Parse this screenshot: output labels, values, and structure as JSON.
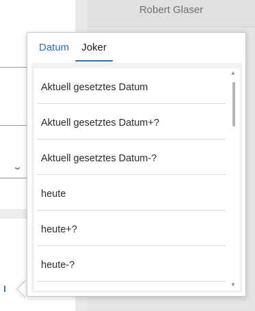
{
  "background": {
    "person_name": "Robert Glaser"
  },
  "flyout": {
    "tabs": [
      {
        "label": "Datum",
        "active": false
      },
      {
        "label": "Joker",
        "active": true
      }
    ],
    "items": [
      {
        "label": "Aktuell gesetztes Datum"
      },
      {
        "label": "Aktuell gesetztes Datum+?"
      },
      {
        "label": "Aktuell gesetztes Datum-?"
      },
      {
        "label": "heute"
      },
      {
        "label": "heute+?"
      },
      {
        "label": "heute-?"
      }
    ]
  },
  "icons": {
    "scroll_up": "triangle-up-icon",
    "scroll_down": "triangle-down-icon",
    "dropdown": "chevron-down-icon"
  },
  "colors": {
    "accent": "#2a6fc4"
  }
}
